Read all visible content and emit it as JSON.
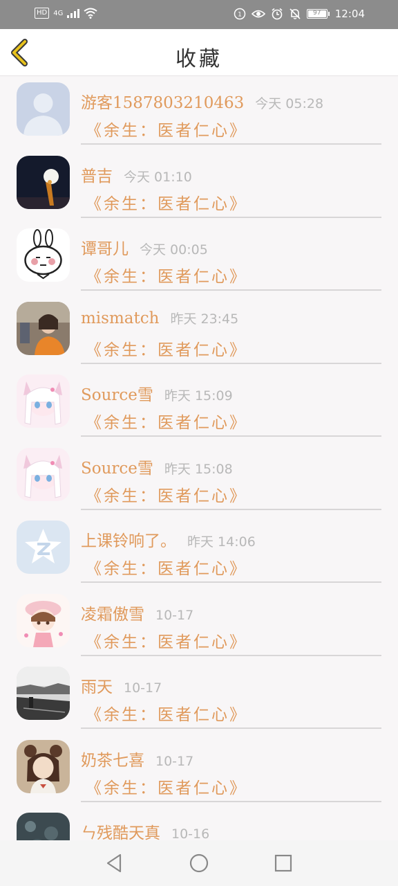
{
  "status_bar": {
    "hd": "HD",
    "network": "4G",
    "battery": "97",
    "time": "12:04"
  },
  "header": {
    "title": "收藏",
    "back_icon": "chevron-left-icon"
  },
  "items": [
    {
      "name": "游客1587803210463",
      "time": "今天 05:28",
      "book": "《余生：医者仁心》",
      "avatar": "default-person"
    },
    {
      "name": "普吉",
      "time": "今天 01:10",
      "book": "《余生：医者仁心》",
      "avatar": "moon-night"
    },
    {
      "name": "谭哥儿",
      "time": "今天 00:05",
      "book": "《余生：医者仁心》",
      "avatar": "rabbit-cartoon"
    },
    {
      "name": "mismatch",
      "time": "昨天 23:45",
      "book": "《余生：医者仁心》",
      "avatar": "girl-photo"
    },
    {
      "name": "Source雪",
      "time": "昨天 15:09",
      "book": "《余生：医者仁心》",
      "avatar": "anime-girl"
    },
    {
      "name": "Source雪",
      "time": "昨天 15:08",
      "book": "《余生：医者仁心》",
      "avatar": "anime-girl"
    },
    {
      "name": "上课铃响了。",
      "time": "昨天 14:06",
      "book": "《余生：医者仁心》",
      "avatar": "qzone-star"
    },
    {
      "name": "凌霜傲雪",
      "time": "10-17",
      "book": "《余生：医者仁心》",
      "avatar": "chibi-girl"
    },
    {
      "name": "雨天",
      "time": "10-17",
      "book": "《余生：医者仁心》",
      "avatar": "rainy-landscape"
    },
    {
      "name": "奶茶七喜",
      "time": "10-17",
      "book": "《余生：医者仁心》",
      "avatar": "bear-ears-girl"
    },
    {
      "name": "ㄣ残酷天真",
      "time": "10-16",
      "book": "",
      "avatar": "dark-texture"
    }
  ],
  "nav": {
    "back": "triangle-back-icon",
    "home": "circle-home-icon",
    "recent": "square-recent-icon"
  },
  "colors": {
    "accent": "#e09a5c",
    "time": "#b8b8b8",
    "status_bar": "#8c8c8c",
    "back_arrow": "#e8c21c"
  }
}
